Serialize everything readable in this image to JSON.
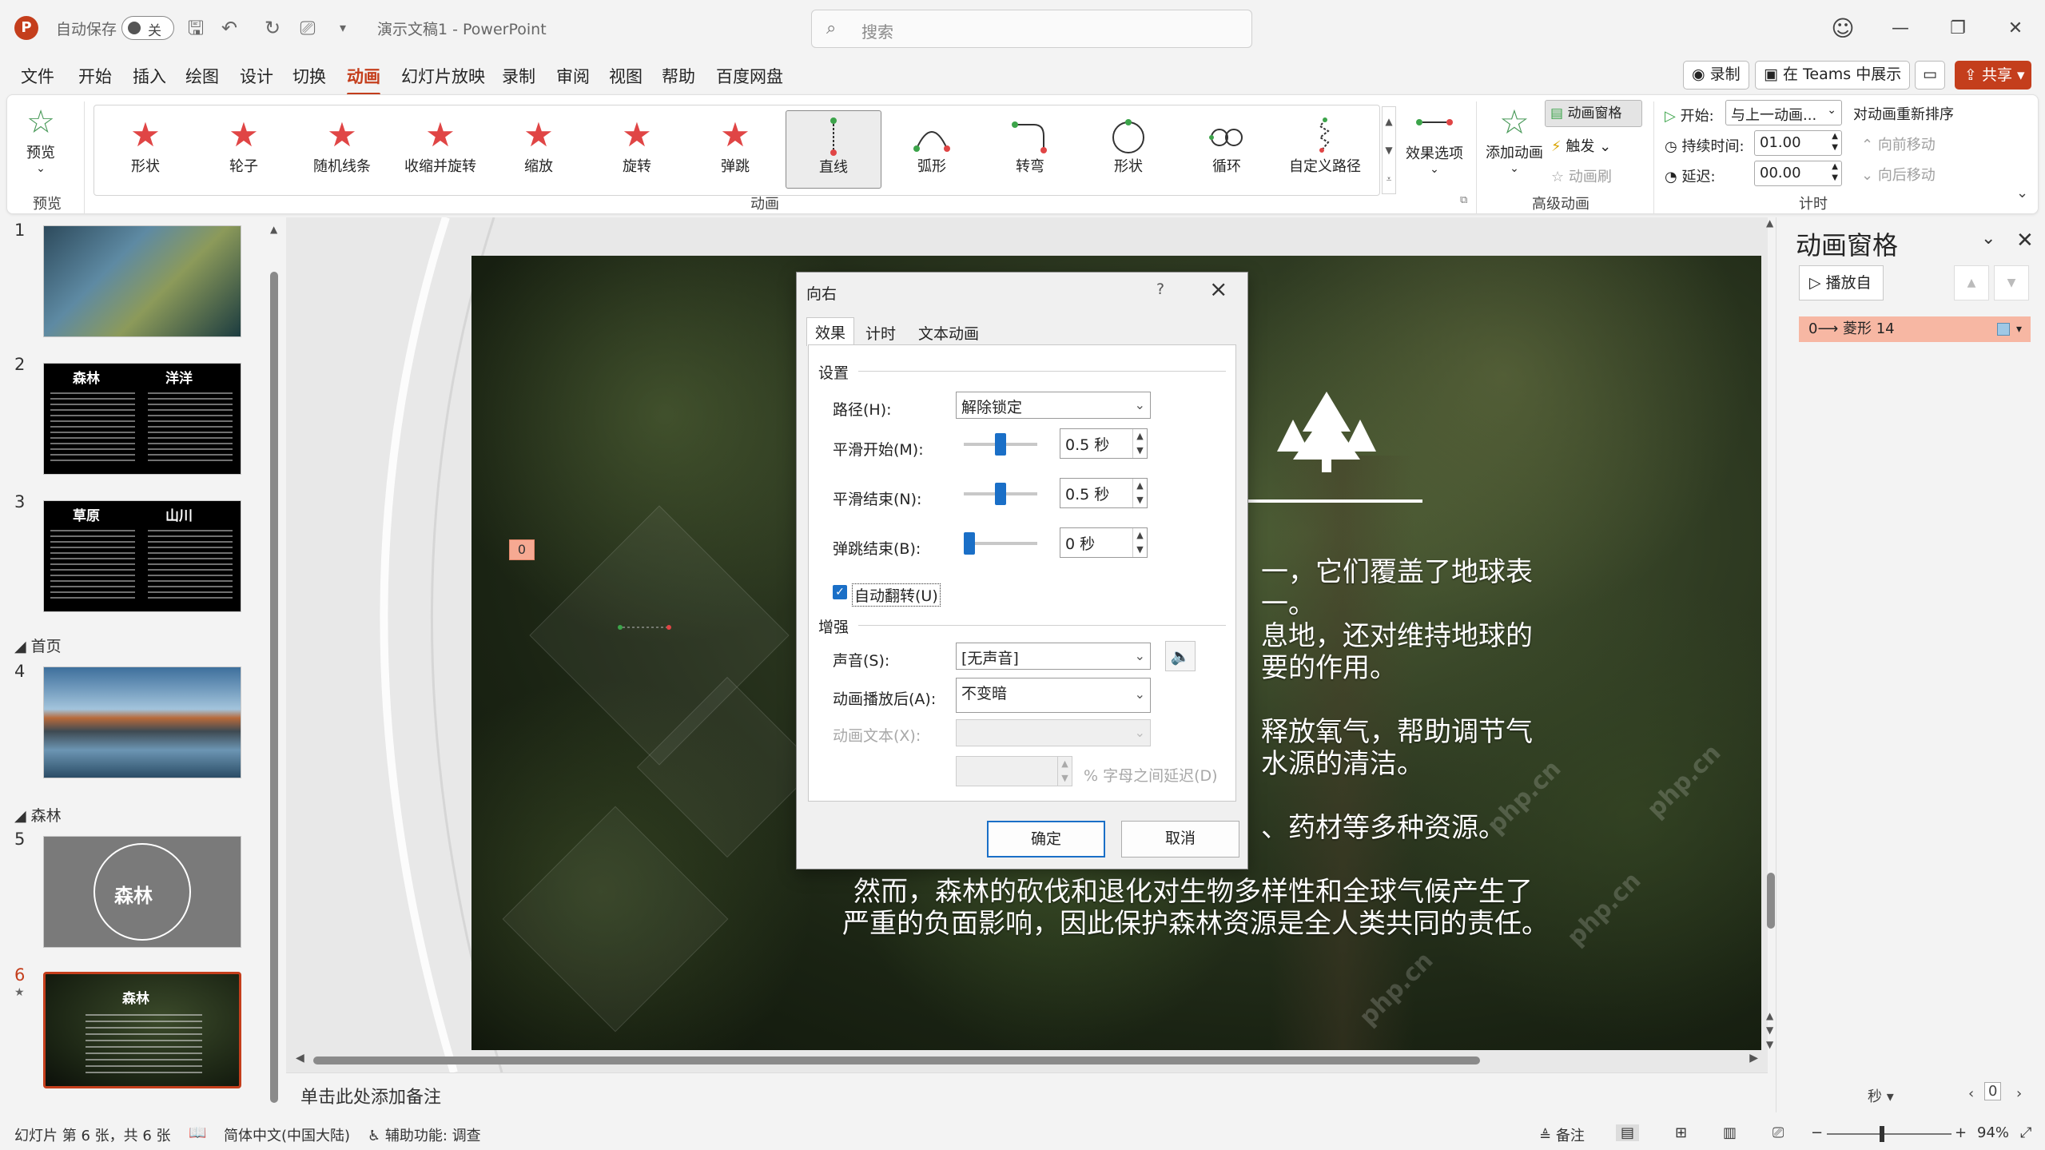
{
  "titlebar": {
    "app_icon": "P",
    "autosave_label": "自动保存",
    "autosave_state": "关",
    "doc_title": "演示文稿1 - PowerPoint",
    "search_placeholder": "搜索"
  },
  "menu": {
    "tabs": [
      "文件",
      "开始",
      "插入",
      "绘图",
      "设计",
      "切换",
      "动画",
      "幻灯片放映",
      "录制",
      "审阅",
      "视图",
      "帮助",
      "百度网盘"
    ],
    "active": "动画",
    "record_label": "录制",
    "teams_label": "在 Teams 中展示",
    "share_label": "共享"
  },
  "ribbon": {
    "preview_label": "预览",
    "preview_group": "预览",
    "animations_group": "动画",
    "advanced_group": "高级动画",
    "timing_group": "计时",
    "gallery": [
      {
        "label": "形状",
        "icon": "star-icon"
      },
      {
        "label": "轮子",
        "icon": "star-icon"
      },
      {
        "label": "随机线条",
        "icon": "star-icon"
      },
      {
        "label": "收缩并旋转",
        "icon": "star-icon"
      },
      {
        "label": "缩放",
        "icon": "star-icon"
      },
      {
        "label": "旋转",
        "icon": "star-icon"
      },
      {
        "label": "弹跳",
        "icon": "star-icon"
      },
      {
        "label": "直线",
        "icon": "line-path-icon"
      },
      {
        "label": "弧形",
        "icon": "arc-path-icon"
      },
      {
        "label": "转弯",
        "icon": "turn-path-icon"
      },
      {
        "label": "形状",
        "icon": "circle-path-icon"
      },
      {
        "label": "循环",
        "icon": "loop-path-icon"
      },
      {
        "label": "自定义路径",
        "icon": "custom-path-icon"
      }
    ],
    "selected_gallery": "直线",
    "effect_options": "效果选项",
    "add_animation": "添加动画",
    "animation_pane": "动画窗格",
    "trigger": "触发",
    "animation_painter": "动画刷",
    "start_label": "开始:",
    "start_value": "与上一动画...",
    "duration_label": "持续时间:",
    "duration_value": "01.00",
    "delay_label": "延迟:",
    "delay_value": "00.00",
    "reorder_label": "对动画重新排序",
    "move_earlier": "向前移动",
    "move_later": "向后移动"
  },
  "thumbnails": {
    "slides": [
      {
        "num": "1"
      },
      {
        "num": "2",
        "title_left": "森林",
        "title_right": "洋洋"
      },
      {
        "num": "3",
        "title_left": "草原",
        "title_right": "山川"
      },
      {
        "num": "4"
      },
      {
        "num": "5",
        "title": "森林"
      },
      {
        "num": "6",
        "title": "森林"
      }
    ],
    "sections": [
      "首页",
      "森林"
    ],
    "active_slide": "6"
  },
  "slide": {
    "anim_tag": "0",
    "lines": [
      "一，它们覆盖了地球表",
      "一。",
      "息地，还对维持地球的",
      "要的作用。",
      "释放氧气，帮助调节气",
      "水源的清洁。",
      "、药材等多种资源。",
      "然而，森林的砍伐和退化对生物多样性和全球气候产生了",
      "严重的负面影响，因此保护森林资源是全人类共同的责任。"
    ]
  },
  "notes_placeholder": "单击此处添加备注",
  "dialog": {
    "title": "向右",
    "help": "?",
    "tabs": [
      "效果",
      "计时",
      "文本动画"
    ],
    "active_tab": "效果",
    "settings_label": "设置",
    "path_label": "路径(H):",
    "path_value": "解除锁定",
    "smooth_start_label": "平滑开始(M):",
    "smooth_start_value": "0.5 秒",
    "smooth_start_level": 0.5,
    "smooth_end_label": "平滑结束(N):",
    "smooth_end_value": "0.5 秒",
    "smooth_end_level": 0.5,
    "bounce_end_label": "弹跳结束(B):",
    "bounce_end_value": "0 秒",
    "bounce_end_level": 0.0,
    "auto_reverse_label": "自动翻转(U)",
    "auto_reverse_checked": true,
    "enhance_label": "增强",
    "sound_label": "声音(S):",
    "sound_value": "[无声音]",
    "after_anim_label": "动画播放后(A):",
    "after_anim_value": "不变暗",
    "anim_text_label": "动画文本(X):",
    "delay_pct_label": "% 字母之间延迟(D)",
    "ok": "确定",
    "cancel": "取消"
  },
  "anim_pane": {
    "title": "动画窗格",
    "play_from": "播放自",
    "item_label": "0⟶ 菱形 14",
    "seconds_label": "秒",
    "page_value": "0"
  },
  "statusbar": {
    "slide_info": "幻灯片 第 6 张，共 6 张",
    "language": "简体中文(中国大陆)",
    "accessibility": "辅助功能: 调查",
    "notes": "备注",
    "zoom": "94%"
  },
  "watermark": "php.cn"
}
